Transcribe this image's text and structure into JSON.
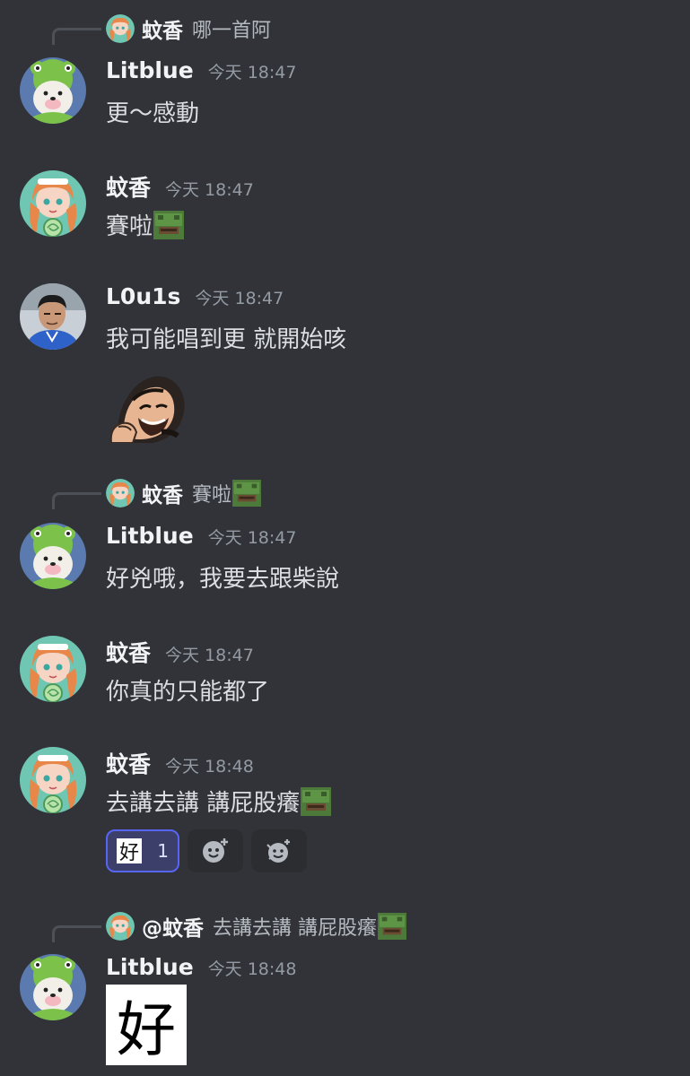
{
  "messages": [
    {
      "reply": {
        "author": "蚊香",
        "text": "哪一首阿",
        "avatar": "avatar-wenxiang-icon"
      },
      "author": "Litblue",
      "time": "今天 18:47",
      "text": "更～感動",
      "avatar": "avatar-shiba-frog-icon"
    },
    {
      "author": "蚊香",
      "time": "今天 18:47",
      "text": "賽啦",
      "emoji": "frog-emoji",
      "avatar": "avatar-wenxiang-icon"
    },
    {
      "author": "L0u1s",
      "time": "今天 18:47",
      "text": "我可能唱到更  就開始咳",
      "sticker": "laughing-man-emoji",
      "avatar": "avatar-louis-icon"
    },
    {
      "reply": {
        "author": "蚊香",
        "text": "賽啦",
        "emoji": "frog-emoji"
      },
      "author": "Litblue",
      "time": "今天 18:47",
      "text": "好兇哦，我要去跟柴說"
    },
    {
      "author": "蚊香",
      "time": "今天 18:47",
      "text": "你真的只能都了"
    },
    {
      "author": "蚊香",
      "time": "今天 18:48",
      "text": "去講去講 講屁股癢",
      "emoji": "frog-emoji",
      "reactions": [
        {
          "emoji": "好",
          "count": "1"
        }
      ]
    },
    {
      "reply": {
        "author": "@蚊香",
        "text": "去講去講 講屁股癢",
        "emoji": "frog-emoji"
      },
      "author": "Litblue",
      "time": "今天 18:48",
      "image_text": "好"
    }
  ],
  "colors": {
    "background": "#313338",
    "username": "#f2f3f5",
    "timestamp": "#949ba4",
    "text": "#dbdee1",
    "accent": "#5865f2"
  }
}
